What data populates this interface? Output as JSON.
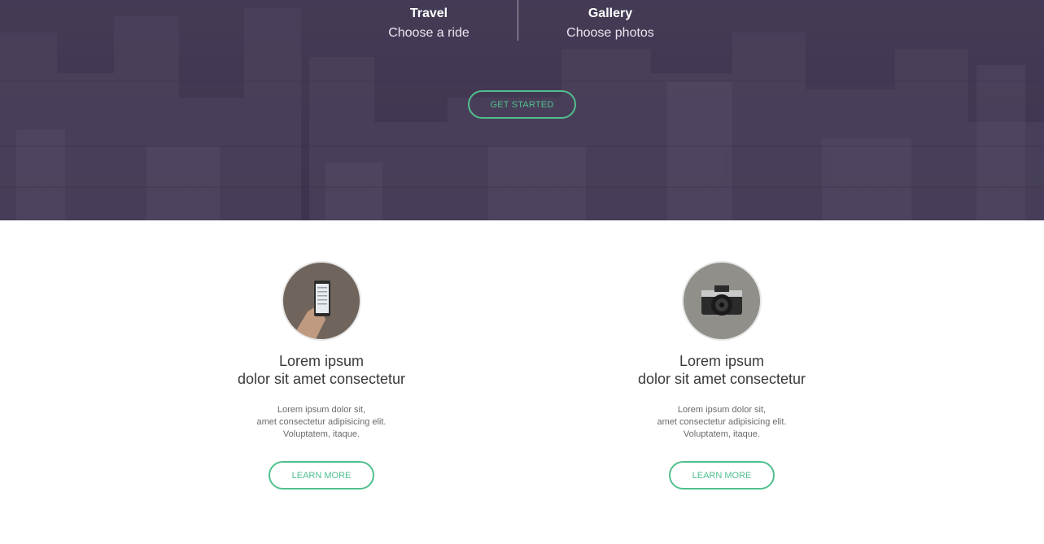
{
  "hero": {
    "items": [
      {
        "title": "Travel",
        "subtitle": "Choose a ride"
      },
      {
        "title": "Gallery",
        "subtitle": "Choose photos"
      }
    ],
    "cta_label": "GET STARTED"
  },
  "cards": [
    {
      "heading_line1": "Lorem ipsum",
      "heading_line2": "dolor sit amet consectetur",
      "text_line1": "Lorem ipsum dolor sit,",
      "text_line2": "amet consectetur adipisicing elit.",
      "text_line3": "Voluptatem, itaque.",
      "button_label": "LEARN MORE",
      "image_icon": "phone-in-hand-photo"
    },
    {
      "heading_line1": "Lorem ipsum",
      "heading_line2": "dolor sit amet consectetur",
      "text_line1": "Lorem ipsum dolor sit,",
      "text_line2": "amet consectetur adipisicing elit.",
      "text_line3": "Voluptatem, itaque.",
      "button_label": "LEARN MORE",
      "image_icon": "camera-photo"
    }
  ],
  "colors": {
    "accent": "#4fc08d",
    "hero_bg": "#453b54",
    "text_dark": "#3a3a3a"
  }
}
